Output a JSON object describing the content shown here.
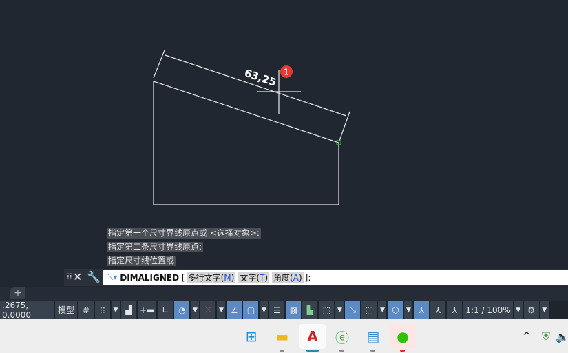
{
  "drawing": {
    "dimension_text": "63,25",
    "badge": "1"
  },
  "command_history": [
    "指定第一个尺寸界线原点或 <选择对象>:",
    "指定第二条尺寸界线原点:",
    "指定尺寸线位置或"
  ],
  "command_line": {
    "command": "DIMALIGNED",
    "open": "[",
    "options": [
      {
        "label": "多行文字(",
        "key": "M",
        "close": ")"
      },
      {
        "label": "文字(",
        "key": "T",
        "close": ")"
      },
      {
        "label": "角度(",
        "key": "A",
        "close": ")"
      }
    ],
    "end": "]:"
  },
  "tabs": {
    "add": "+"
  },
  "status_bar": {
    "coords": ".2675, 0.0000",
    "model": "模型",
    "scale": "1:1 / 100%"
  },
  "colors": {
    "background": "#212730",
    "accent": "#5b8ac4",
    "badge": "#e53935"
  }
}
